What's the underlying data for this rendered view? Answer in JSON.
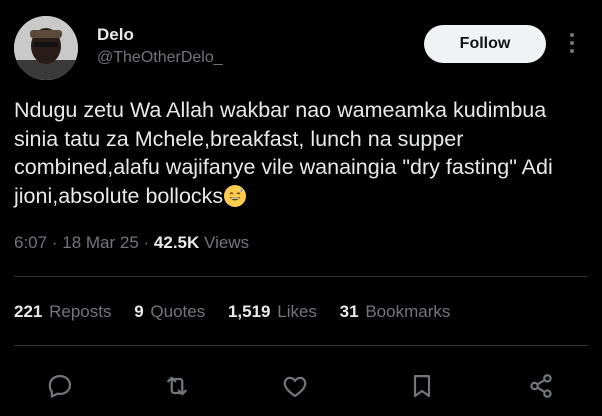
{
  "author": {
    "name": "Delo",
    "handle": "@TheOtherDelo_",
    "follow_label": "Follow"
  },
  "tweet": {
    "text": "Ndugu zetu Wa Allah wakbar nao wameamka kudimbua sinia tatu za Mchele,breakfast, lunch na supper combined,alafu wajifanye vile wanaingia \"dry fasting\" Adi jioni,absolute bollocks",
    "emoji": "grinning-sweat-face-emoji"
  },
  "meta": {
    "time": "6:07",
    "separator": "·",
    "date": "18 Mar 25",
    "views_count": "42.5K",
    "views_label": "Views"
  },
  "stats": [
    {
      "count": "221",
      "label": "Reposts"
    },
    {
      "count": "9",
      "label": "Quotes"
    },
    {
      "count": "1,519",
      "label": "Likes"
    },
    {
      "count": "31",
      "label": "Bookmarks"
    }
  ],
  "icons": {
    "more": "more-icon",
    "reply": "reply-icon",
    "repost": "repost-icon",
    "like": "heart-icon",
    "bookmark": "bookmark-icon",
    "share": "share-icon"
  },
  "colors": {
    "background": "#000000",
    "text": "#e7e9ea",
    "muted": "#71767b",
    "divider": "#2f3336",
    "follow_bg": "#eff3f4"
  }
}
